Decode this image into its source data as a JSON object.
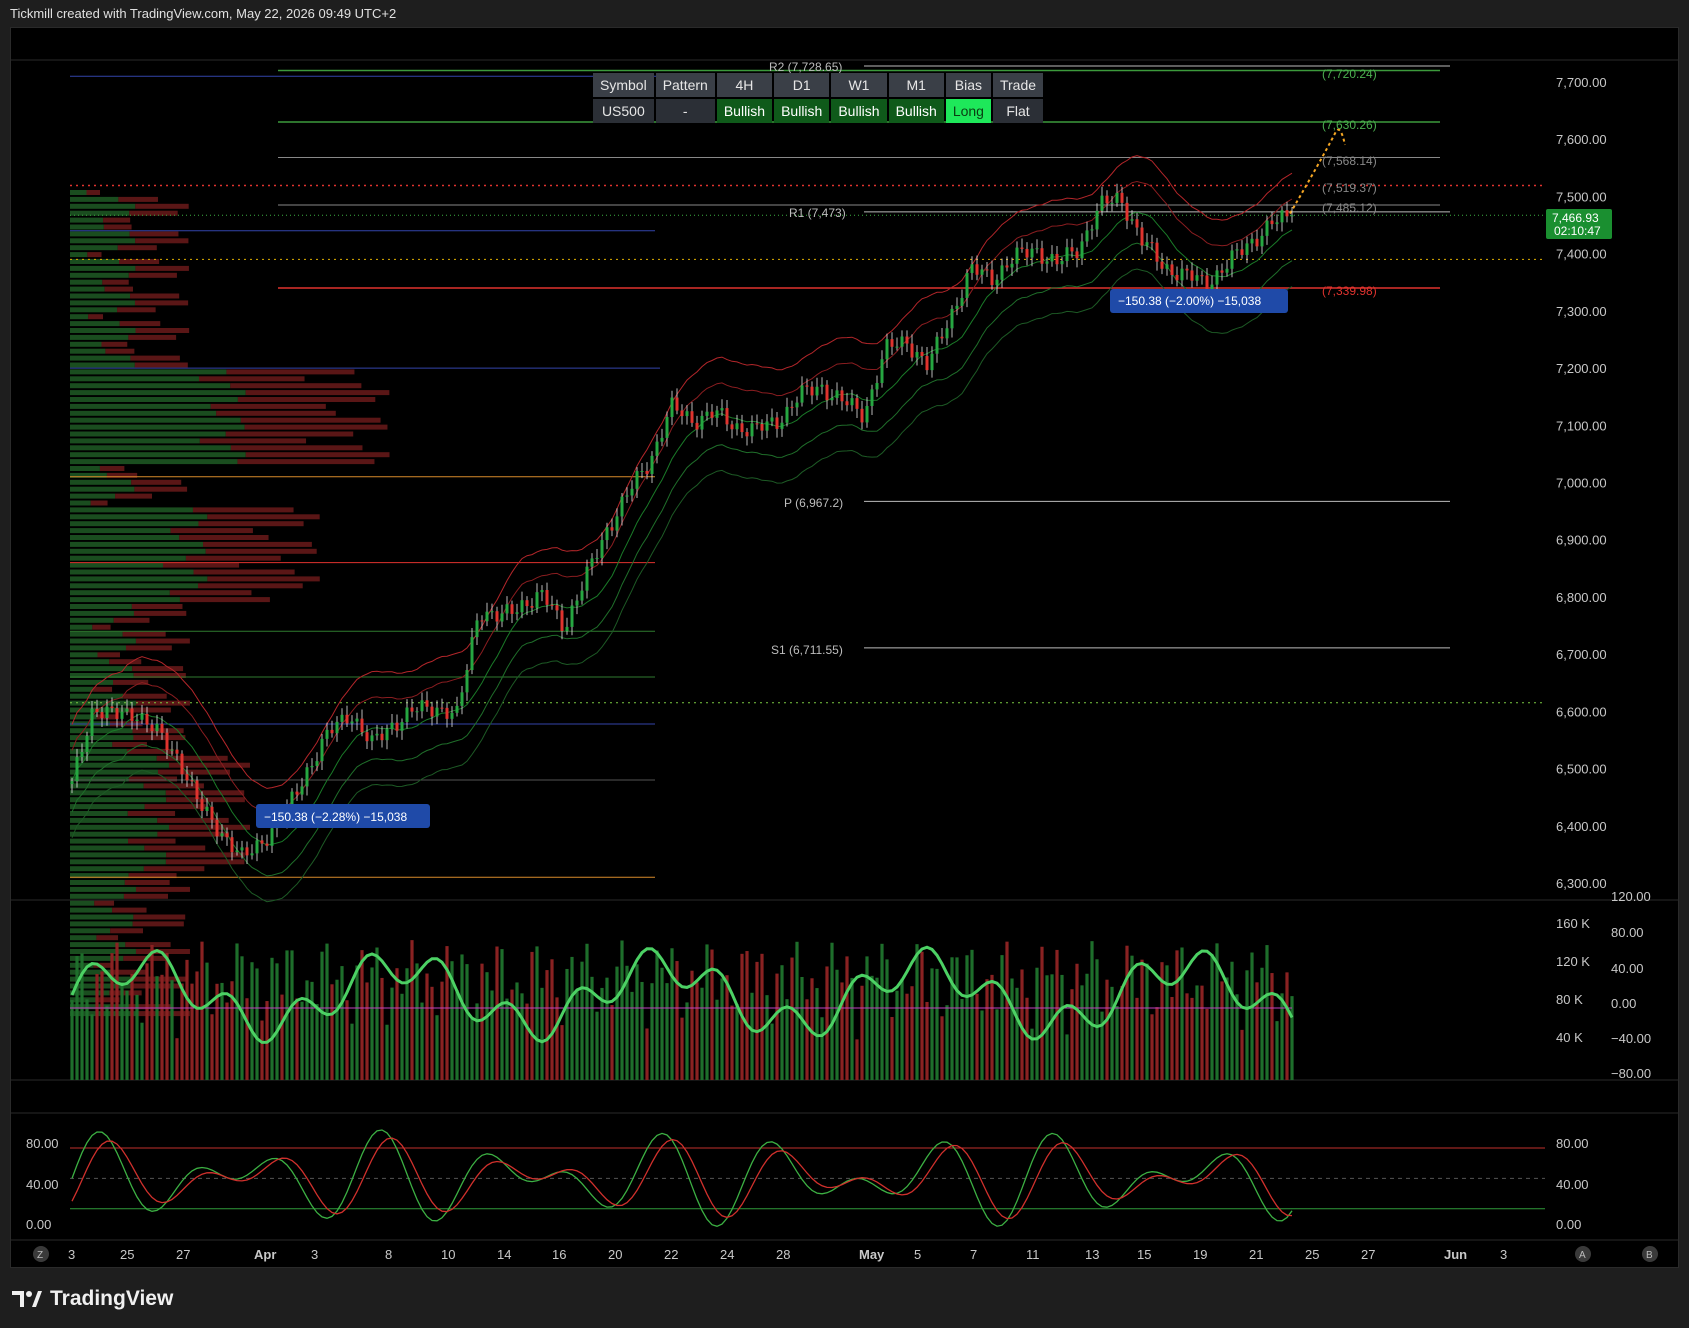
{
  "header": {
    "title": "Tickmill created with TradingView.com, May 22, 2026 09:49 UTC+2"
  },
  "footer": {
    "brand": "TradingView"
  },
  "colors": {
    "bull": "#26a641",
    "bear": "#e0332e",
    "accent_long": "#1ee85a"
  },
  "info_table": {
    "headers": [
      "Symbol",
      "Pattern",
      "4H",
      "D1",
      "W1",
      "M1",
      "Bias",
      "Trade"
    ],
    "values": [
      "US500",
      "-",
      "Bullish",
      "Bullish",
      "Bullish",
      "Bullish",
      "Long",
      "Flat"
    ]
  },
  "pivots": {
    "r2": "R2 (7,728.65)",
    "r1": "R1 (7,473)",
    "p": "P (6,967.2)",
    "s1": "S1 (6,711.55)"
  },
  "levels": {
    "l1": "(7,720.24)",
    "l2": "(7,630.26)",
    "l3": "(7,568.14)",
    "l4": "(7,519.37)",
    "l5": "(7,485.12)",
    "l6": "(7,339.98)"
  },
  "price_badge": {
    "price": "7,466.93",
    "countdown": "02:10:47"
  },
  "measure_labels": {
    "left": "−150.38 (−2.28%) −15,038",
    "right": "−150.38 (−2.00%) −15,038"
  },
  "bottom_buttons": {
    "left": "Z",
    "right_a": "A",
    "right_b": "B"
  },
  "chart_data": [
    {
      "type": "candlestick",
      "title": "",
      "ylim": [
        6280,
        7780
      ],
      "y_ticks": [
        "7,700.00",
        "7,600.00",
        "7,500.00",
        "7,400.00",
        "7,300.00",
        "7,200.00",
        "7,100.00",
        "7,000.00",
        "6,900.00",
        "6,800.00",
        "6,700.00",
        "6,600.00",
        "6,500.00",
        "6,400.00",
        "6,300.00"
      ],
      "x_ticks": [
        "3",
        "25",
        "27",
        "Apr",
        "3",
        "8",
        "10",
        "14",
        "16",
        "20",
        "22",
        "24",
        "28",
        "May",
        "5",
        "7",
        "11",
        "13",
        "15",
        "19",
        "21",
        "25",
        "27",
        "Jun",
        "3"
      ],
      "close_path": [
        6470,
        6610,
        6590,
        6600,
        6560,
        6520,
        6430,
        6390,
        6340,
        6380,
        6420,
        6500,
        6560,
        6600,
        6540,
        6580,
        6600,
        6610,
        6590,
        6780,
        6760,
        6790,
        6800,
        6750,
        6830,
        6920,
        6980,
        7040,
        7130,
        7110,
        7120,
        7100,
        7090,
        7110,
        7150,
        7170,
        7140,
        7120,
        7230,
        7250,
        7200,
        7290,
        7370,
        7360,
        7390,
        7410,
        7380,
        7410,
        7480,
        7500,
        7420,
        7380,
        7360,
        7350,
        7380,
        7420,
        7450,
        7467
      ],
      "last_price": 7466.93
    },
    {
      "type": "bar",
      "title": "",
      "volume_ticks": [
        "160 K",
        "120 K",
        "80 K",
        "40 K"
      ],
      "oscillator_ticks": [
        "120.00",
        "80.00",
        "40.00",
        "0.00",
        "−40.00",
        "−80.00"
      ]
    },
    {
      "type": "line",
      "title": "",
      "ticks": [
        "80.00",
        "40.00",
        "0.00"
      ],
      "overbought": 80,
      "oversold": 20
    }
  ]
}
